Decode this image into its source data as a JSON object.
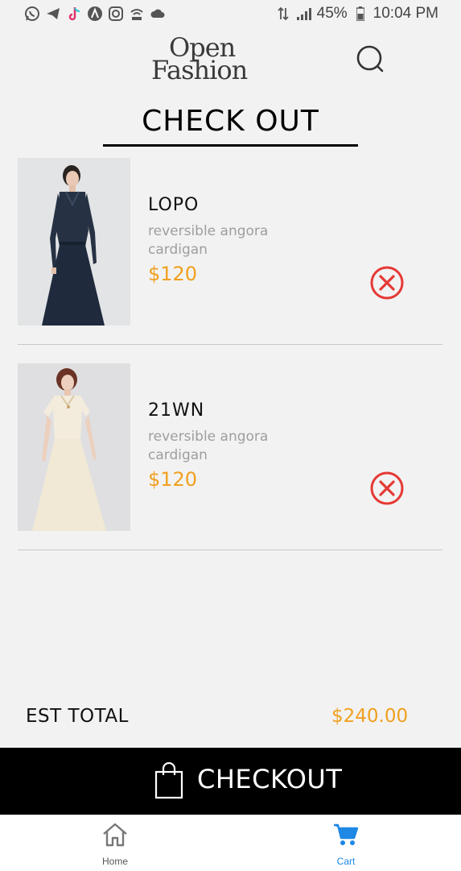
{
  "status_bar": {
    "battery": "45%",
    "time": "10:04 PM"
  },
  "header": {
    "logo_line1": "Open",
    "logo_line2": "Fashion"
  },
  "page": {
    "title": "CHECK OUT"
  },
  "cart": {
    "items": [
      {
        "name": "LOPO",
        "description": "reversible angora cardigan",
        "price": "$120"
      },
      {
        "name": "21WN",
        "description": "reversible angora cardigan",
        "price": "$120"
      }
    ]
  },
  "summary": {
    "total_label": "EST TOTAL",
    "total_value": "$240.00"
  },
  "checkout": {
    "label": "CHECKOUT"
  },
  "nav": {
    "home_label": "Home",
    "cart_label": "Cart"
  },
  "colors": {
    "accent_price": "#f0a020",
    "remove_red": "#e53935",
    "active_nav": "#1e88e5",
    "checkout_bg": "#000000"
  }
}
